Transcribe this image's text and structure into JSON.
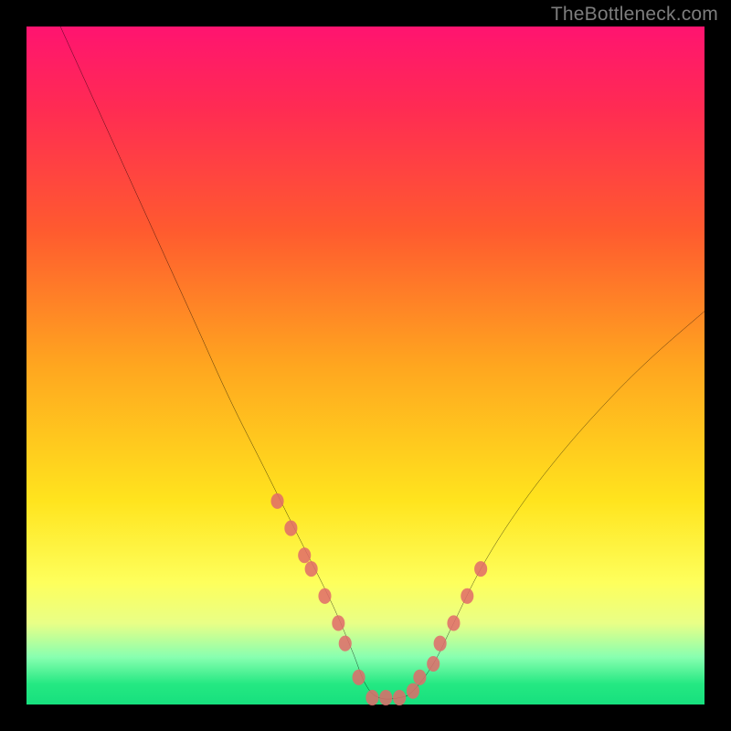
{
  "watermark": "TheBottleneck.com",
  "chart_data": {
    "type": "line",
    "title": "",
    "xlabel": "",
    "ylabel": "",
    "xlim": [
      0,
      100
    ],
    "ylim": [
      0,
      100
    ],
    "series": [
      {
        "name": "curve",
        "x": [
          5,
          10,
          15,
          20,
          25,
          30,
          35,
          40,
          45,
          48,
          50,
          52,
          55,
          57,
          60,
          63,
          67,
          72,
          78,
          85,
          92,
          100
        ],
        "y": [
          100,
          89,
          78,
          67,
          56,
          45,
          35,
          25,
          15,
          8,
          3,
          1,
          1,
          2,
          6,
          12,
          20,
          28,
          36,
          44,
          51,
          58
        ]
      }
    ],
    "markers": {
      "name": "pink-dots",
      "x": [
        37,
        39,
        41,
        42,
        44,
        46,
        47,
        49,
        51,
        53,
        55,
        57,
        58,
        60,
        61,
        63,
        65,
        67
      ],
      "y": [
        30,
        26,
        22,
        20,
        16,
        12,
        9,
        4,
        1,
        1,
        1,
        2,
        4,
        6,
        9,
        12,
        16,
        20
      ]
    },
    "background_gradient": {
      "top": "#ff1470",
      "mid1": "#ff5a2f",
      "mid2": "#ffe41e",
      "bottom": "#17e07e"
    }
  }
}
